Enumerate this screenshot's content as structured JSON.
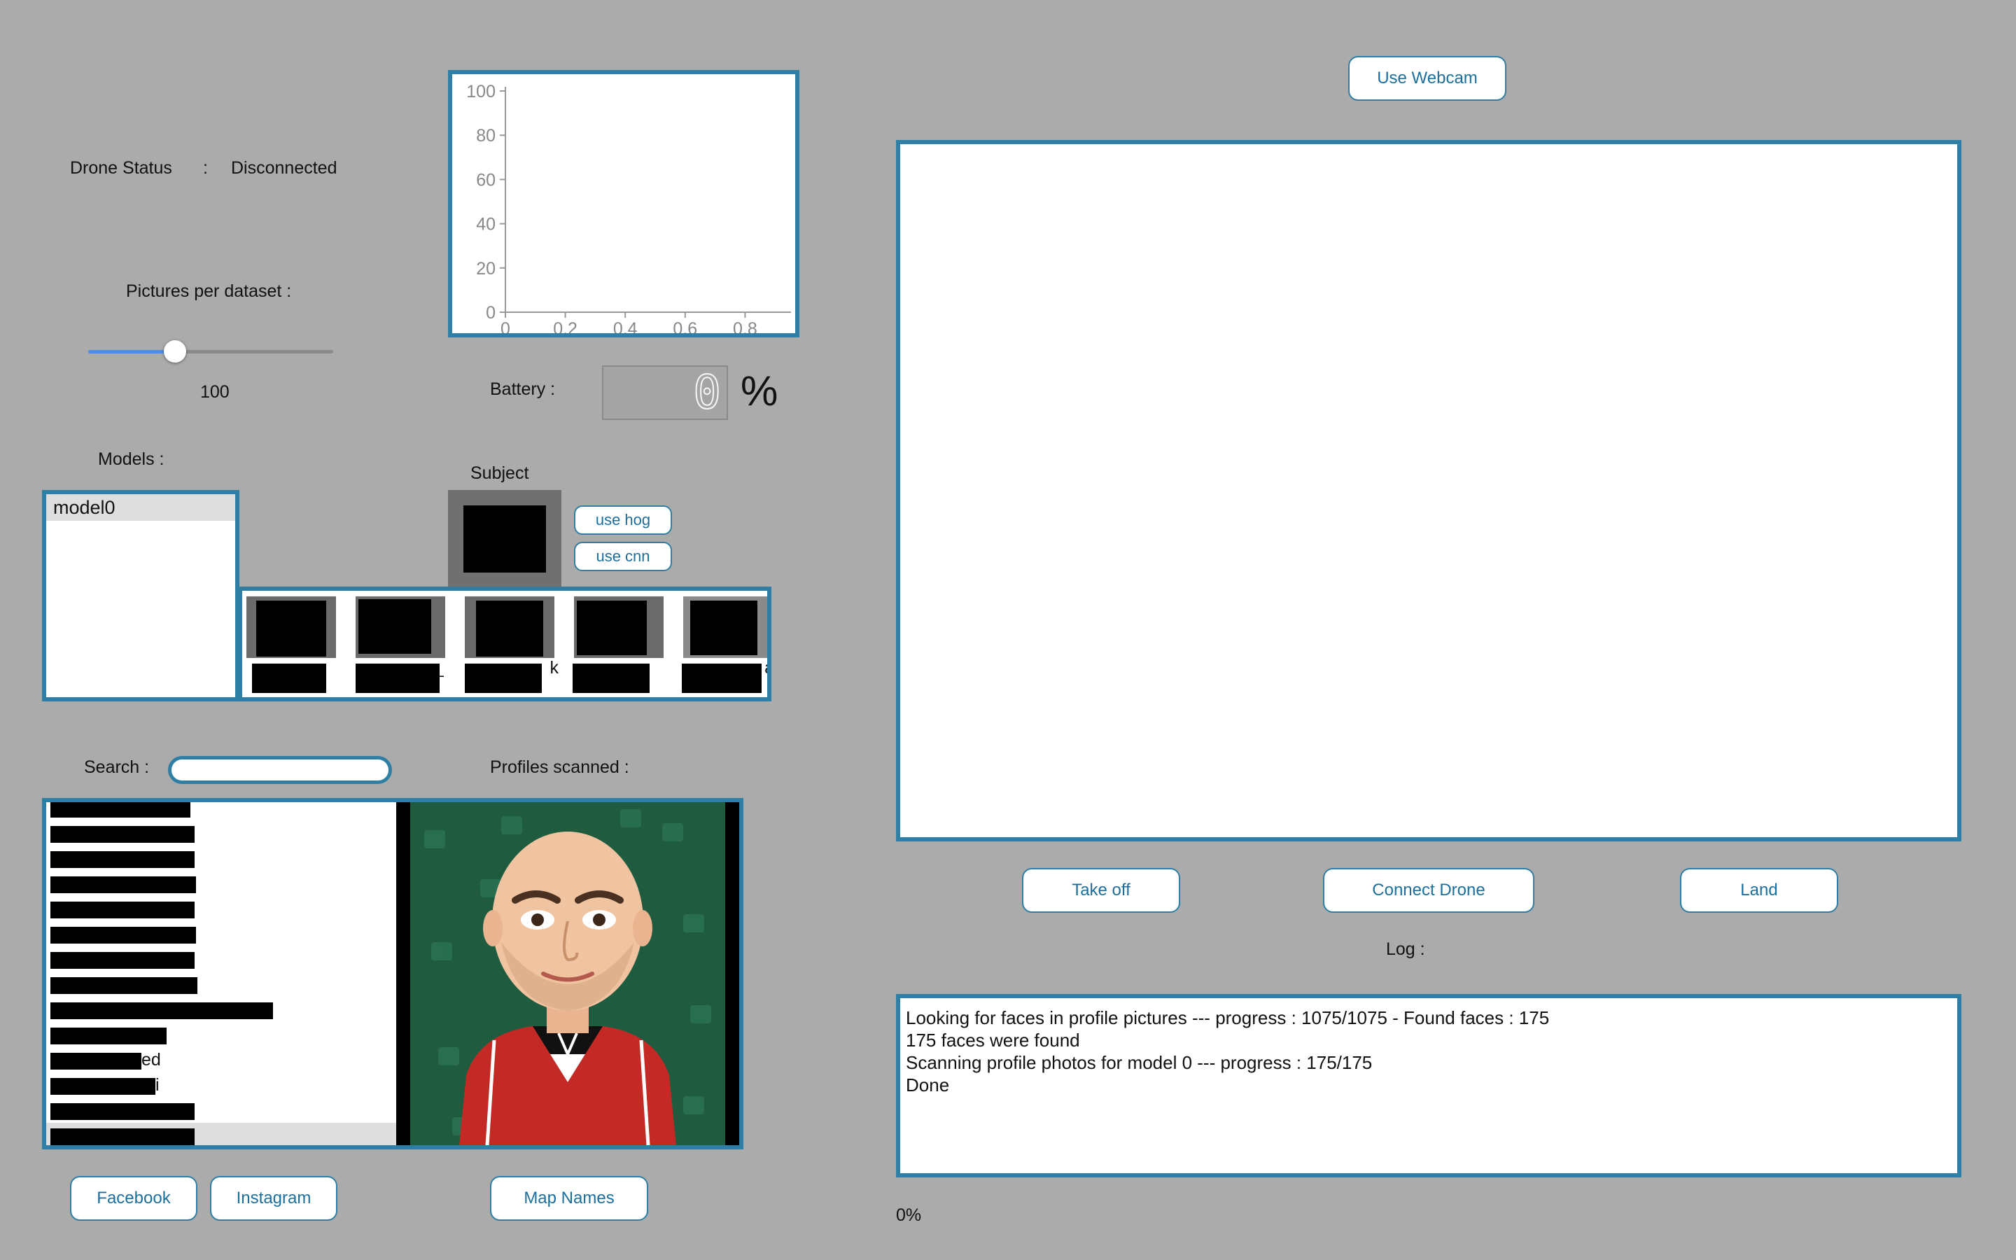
{
  "drone_status": {
    "label": "Drone Status",
    "separator": ":",
    "value": "Disconnected"
  },
  "pictures_per_dataset": {
    "label": "Pictures per dataset :",
    "value": "100",
    "fraction": 0.34
  },
  "chart_data": {
    "type": "line",
    "title": "",
    "xlabel": "",
    "ylabel": "",
    "x_ticks": [
      "0",
      "0.2",
      "0.4",
      "0.6",
      "0.8"
    ],
    "y_ticks": [
      "100",
      "80",
      "60",
      "40",
      "20",
      "0"
    ],
    "xlim": [
      0,
      1
    ],
    "ylim": [
      0,
      100
    ],
    "series": []
  },
  "battery": {
    "label": "Battery :",
    "value": "0",
    "unit": "%"
  },
  "models": {
    "label": "Models :",
    "items": [
      "model0"
    ],
    "selected": "model0"
  },
  "subject": {
    "label": "Subject",
    "use_hog": "use hog",
    "use_cnn": "use cnn",
    "thumbnails": [
      {
        "name": "",
        "count": "18"
      },
      {
        "name": "_",
        "count": "30"
      },
      {
        "name": "k",
        "count": "31"
      },
      {
        "name": "",
        "count": "32"
      },
      {
        "name": "a",
        "count": "32"
      }
    ]
  },
  "search": {
    "label": "Search :",
    "value": "",
    "placeholder": ""
  },
  "profiles_scanned": {
    "label": "Profiles scanned :"
  },
  "profile_list": {
    "rows": [
      "",
      "",
      "",
      "",
      "",
      "",
      "",
      "",
      "",
      "",
      "ed",
      "i",
      "",
      "",
      ""
    ],
    "selected_index": 13
  },
  "buttons": {
    "facebook": "Facebook",
    "instagram": "Instagram",
    "map_names": "Map Names",
    "use_webcam": "Use Webcam",
    "take_off": "Take off",
    "connect_drone": "Connect Drone",
    "land": "Land"
  },
  "log": {
    "label": "Log :",
    "lines": [
      "Looking for faces in profile pictures --- progress : 1075/1075 - Found faces : 175",
      "175 faces were found",
      "Scanning profile photos for model 0 --- progress : 175/175",
      "Done"
    ]
  },
  "progress": {
    "text": "0%",
    "value": 0
  },
  "colors": {
    "background": "#ababab",
    "accent": "#2f7ea3",
    "button_text": "#1c6f9c",
    "slider_fill": "#4a8fe7",
    "avatar_bg": "#1f5b3f",
    "jacket": "#c42a25"
  },
  "icons": {
    "avatar": "bald-cartoon-avatar-icon",
    "adidas_logo": "adidas-logo-icon"
  }
}
